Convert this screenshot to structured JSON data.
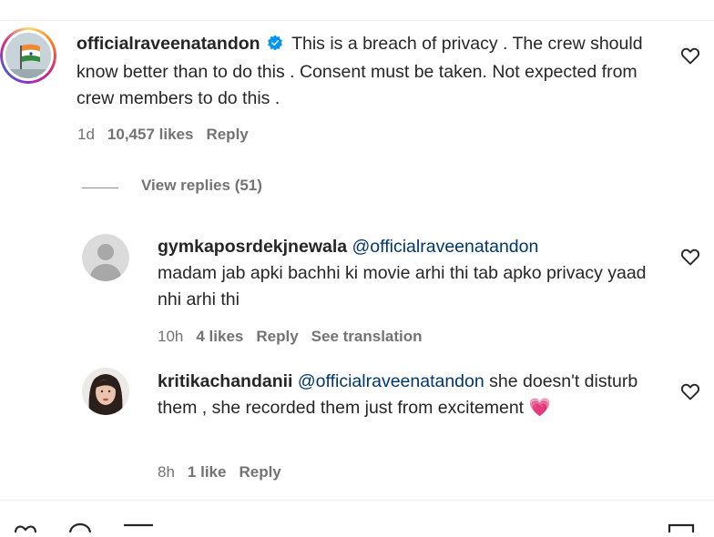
{
  "comments": [
    {
      "username": "officialraveenatandon",
      "verified": true,
      "text": "This is a breach of privacy . The crew should know better than to do this . Consent must be taken. Not expected from crew members to do this .",
      "time": "1d",
      "likes": "10,457 likes",
      "reply_label": "Reply"
    }
  ],
  "view_replies_label": "View replies (51)",
  "replies": [
    {
      "username": "gymkaposrdekjnewala",
      "mention": "@officialraveenatandon",
      "text": "madam jab apki bachhi ki movie arhi thi tab apko privacy yaad nhi arhi thi",
      "time": "10h",
      "likes": "4 likes",
      "reply_label": "Reply",
      "translation_label": "See translation"
    },
    {
      "username": "kritikachandanii",
      "mention": "@officialraveenatandon",
      "text": "she doesn't disturb them , she recorded them just from excitement",
      "emoji": "💗",
      "time": "8h",
      "likes": "1 like",
      "reply_label": "Reply"
    }
  ],
  "colors": {
    "text": "#262626",
    "secondary": "#737373",
    "mention": "#00376b",
    "verified": "#0095f6"
  }
}
